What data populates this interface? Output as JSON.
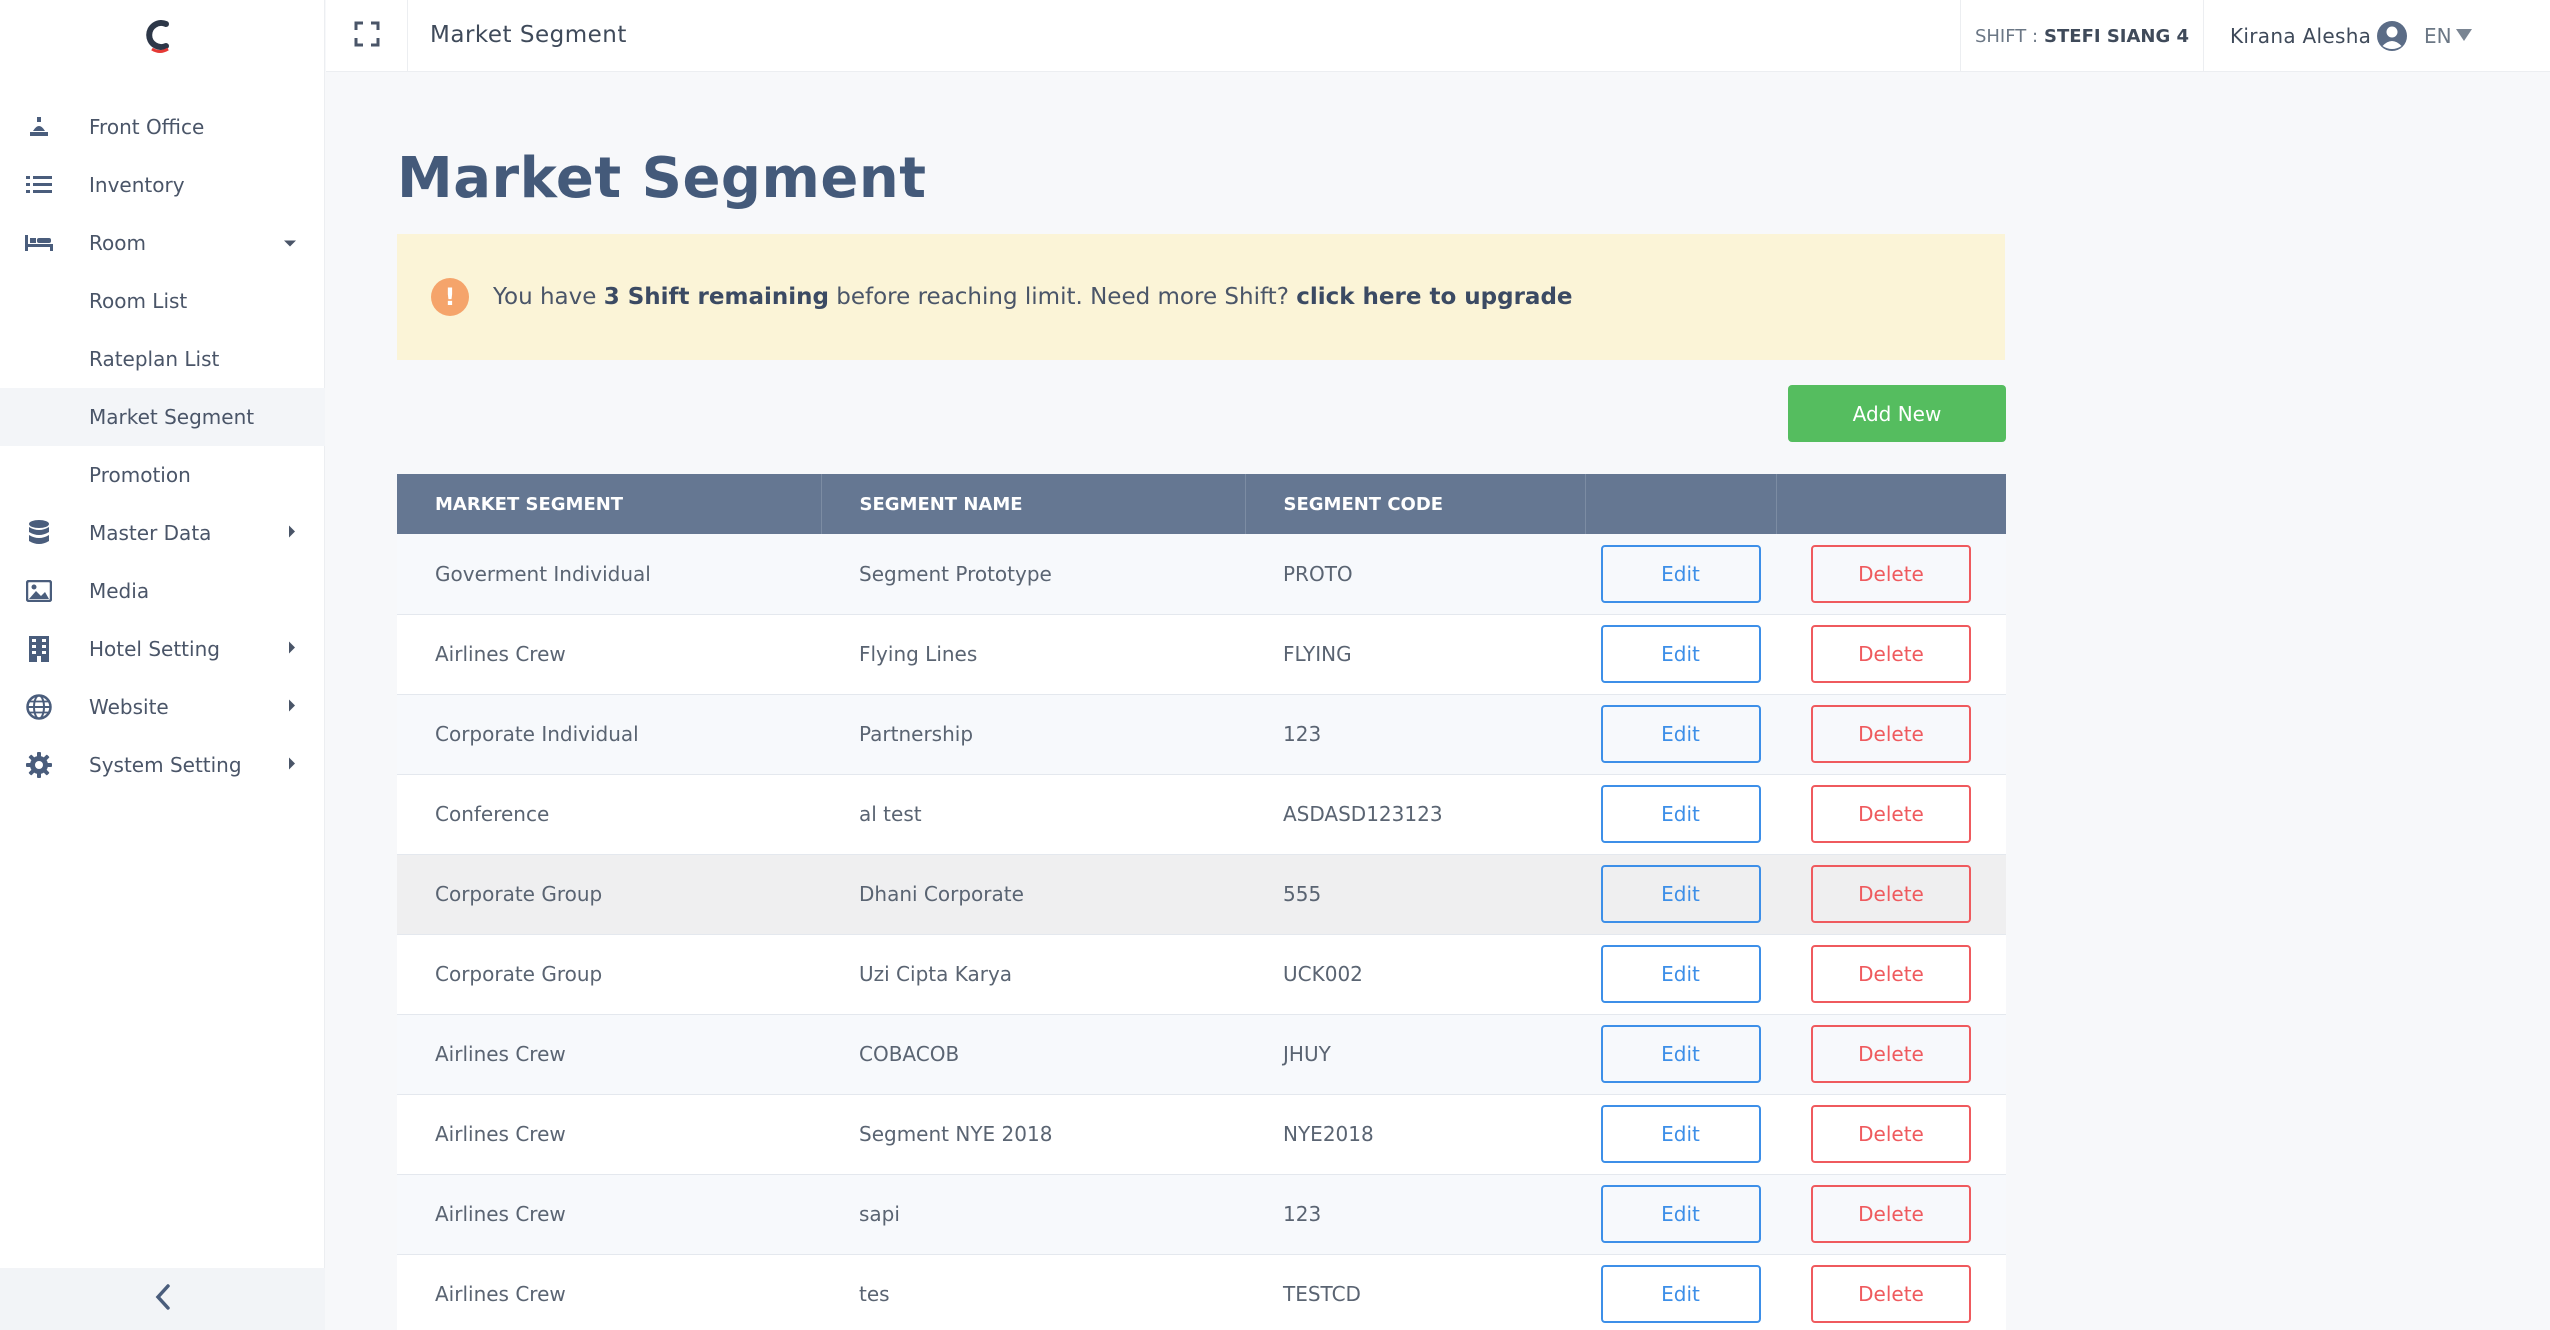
{
  "header": {
    "title": "Market Segment",
    "shift_label": "SHIFT :",
    "shift_value": "STEFI SIANG 4",
    "user_name": "Kirana Alesha",
    "language": "EN"
  },
  "sidebar": {
    "items": [
      {
        "label": "Front Office",
        "icon": "bell-icon"
      },
      {
        "label": "Inventory",
        "icon": "list-icon"
      },
      {
        "label": "Room",
        "icon": "bed-icon",
        "expanded": true
      },
      {
        "label": "Room List"
      },
      {
        "label": "Rateplan List"
      },
      {
        "label": "Market Segment",
        "active": true
      },
      {
        "label": "Promotion"
      },
      {
        "label": "Master Data",
        "icon": "database-icon"
      },
      {
        "label": "Media",
        "icon": "image-icon"
      },
      {
        "label": "Hotel Setting",
        "icon": "building-icon"
      },
      {
        "label": "Website",
        "icon": "globe-icon"
      },
      {
        "label": "System Setting",
        "icon": "gear-icon"
      }
    ]
  },
  "main": {
    "title": "Market Segment",
    "alert": {
      "prefix": "You have ",
      "bold": "3 Shift remaining",
      "middle": " before reaching limit. Need more Shift? ",
      "link": "click here to upgrade"
    },
    "add_button": "Add New",
    "table": {
      "headers": [
        "MARKET SEGMENT",
        "SEGMENT NAME",
        "SEGMENT CODE",
        "",
        ""
      ],
      "edit_label": "Edit",
      "delete_label": "Delete",
      "rows": [
        {
          "segment": "Goverment Individual",
          "name": "Segment Prototype",
          "code": "PROTO"
        },
        {
          "segment": "Airlines Crew",
          "name": "Flying Lines",
          "code": "FLYING"
        },
        {
          "segment": "Corporate Individual",
          "name": "Partnership",
          "code": "123"
        },
        {
          "segment": "Conference",
          "name": "al test",
          "code": "ASDASD123123"
        },
        {
          "segment": "Corporate Group",
          "name": "Dhani Corporate",
          "code": "555"
        },
        {
          "segment": "Corporate Group",
          "name": "Uzi Cipta Karya",
          "code": "UCK002"
        },
        {
          "segment": "Airlines Crew",
          "name": "COBACOB",
          "code": "JHUY"
        },
        {
          "segment": "Airlines Crew",
          "name": "Segment NYE 2018",
          "code": "NYE2018"
        },
        {
          "segment": "Airlines Crew",
          "name": "sapi",
          "code": "123"
        },
        {
          "segment": "Airlines Crew",
          "name": "tes",
          "code": "TESTCD"
        }
      ]
    }
  },
  "colors": {
    "accent": "#445a7a",
    "table_header": "#657792",
    "add_button": "#55bd5f",
    "edit": "#3d8fe8",
    "delete": "#ef5a5e",
    "alert_bg": "#fbf4d7"
  }
}
